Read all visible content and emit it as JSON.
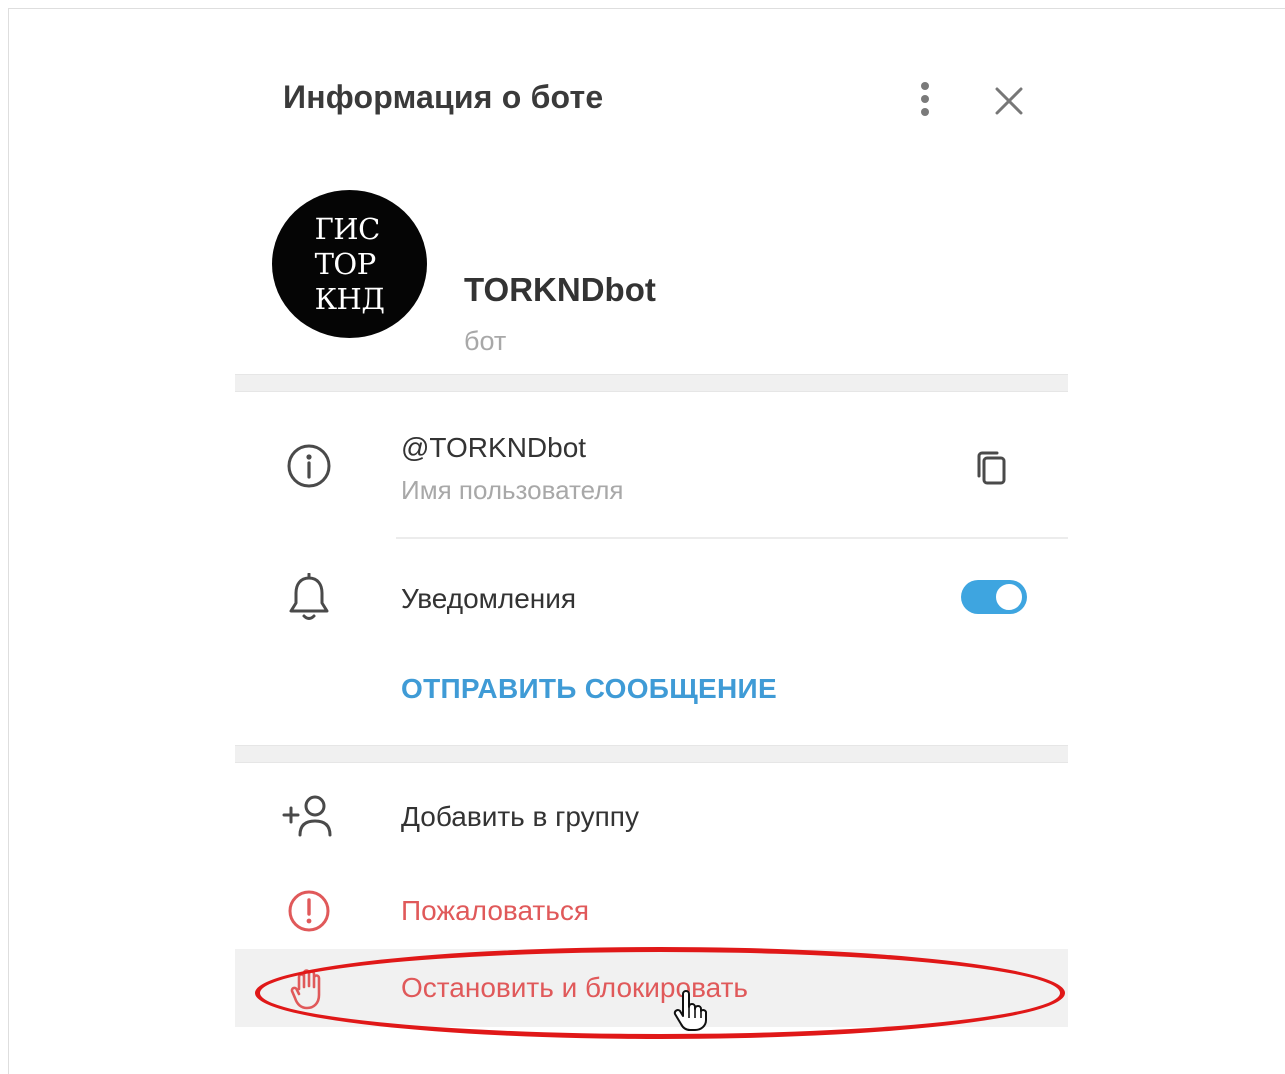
{
  "header": {
    "title": "Информация о боте"
  },
  "profile": {
    "avatar_lines": [
      "ГИС",
      "ТОР",
      "КНД"
    ],
    "name": "TORKNDbot",
    "type": "бот"
  },
  "info": {
    "username": "@TORKNDbot",
    "username_caption": "Имя пользователя",
    "notifications_label": "Уведомления",
    "notifications_enabled": true,
    "send_message_label": "ОТПРАВИТЬ СООБЩЕНИЕ"
  },
  "actions": {
    "add_to_group": "Добавить в группу",
    "report": "Пожаловаться",
    "stop_and_block": "Остановить и блокировать"
  },
  "colors": {
    "accent": "#3ea5e0",
    "link": "#3f9bd6",
    "danger": "#e0595a",
    "highlight": "#e01818"
  },
  "icons": [
    "more-vertical-icon",
    "close-icon",
    "info-icon",
    "copy-icon",
    "bell-icon",
    "add-user-icon",
    "report-icon",
    "hand-stop-icon",
    "cursor-hand-icon"
  ]
}
